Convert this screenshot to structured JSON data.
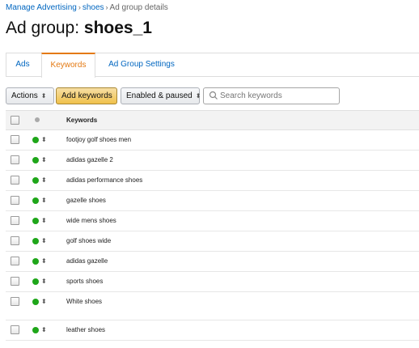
{
  "breadcrumb": {
    "items": [
      "Manage Advertising",
      "shoes",
      "Ad group details"
    ],
    "separator": "›"
  },
  "page_title": {
    "prefix": "Ad group: ",
    "name": "shoes_1"
  },
  "tabs": [
    {
      "label": "Ads",
      "active": false
    },
    {
      "label": "Keywords",
      "active": true
    },
    {
      "label": "Ad Group Settings",
      "active": false
    }
  ],
  "toolbar": {
    "actions_label": "Actions",
    "add_keywords_label": "Add keywords",
    "filter_label": "Enabled & paused",
    "search_placeholder": "Search keywords",
    "search_value": ""
  },
  "table": {
    "header": {
      "keyword_label": "Keywords"
    },
    "rows": [
      {
        "keyword": "footjoy golf shoes men",
        "status": "enabled"
      },
      {
        "keyword": "adidas gazelle 2",
        "status": "enabled"
      },
      {
        "keyword": "adidas performance shoes",
        "status": "enabled"
      },
      {
        "keyword": "gazelle shoes",
        "status": "enabled"
      },
      {
        "keyword": "wide mens shoes",
        "status": "enabled"
      },
      {
        "keyword": "golf shoes wide",
        "status": "enabled"
      },
      {
        "keyword": "adidas gazelle",
        "status": "enabled"
      },
      {
        "keyword": "sports shoes",
        "status": "enabled"
      },
      {
        "keyword": "White shoes",
        "status": "enabled"
      },
      {
        "keyword": "leather shoes",
        "status": "enabled"
      }
    ]
  },
  "colors": {
    "link": "#0066c0",
    "active_tab": "#e47911",
    "primary_button": "#f0c14b",
    "status_enabled": "#1ea619",
    "header_status": "#aaaaaa"
  },
  "icons": {
    "search": "search-icon",
    "dropdown": "chevron-updown-icon",
    "status": "status-dot-icon",
    "breadcrumb_separator": "chevron-right-icon"
  }
}
